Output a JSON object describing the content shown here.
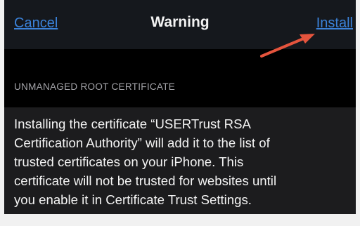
{
  "navbar": {
    "cancel_label": "Cancel",
    "title": "Warning",
    "install_label": "Install"
  },
  "annotation": {
    "arrow_color": "#e5543d"
  },
  "section": {
    "header": "UNMANAGED ROOT CERTIFICATE"
  },
  "warning": {
    "text": "Installing the certificate “USERTrust RSA\nCertification Authority” will add it to the list of\ntrusted certificates on your iPhone. This\ncertificate will not be trusted for websites until\nyou enable it in Certificate Trust Settings."
  },
  "colors": {
    "link": "#3b82d9",
    "background": "#000000",
    "navbar": "#15181d",
    "card": "#1c1c1e"
  }
}
